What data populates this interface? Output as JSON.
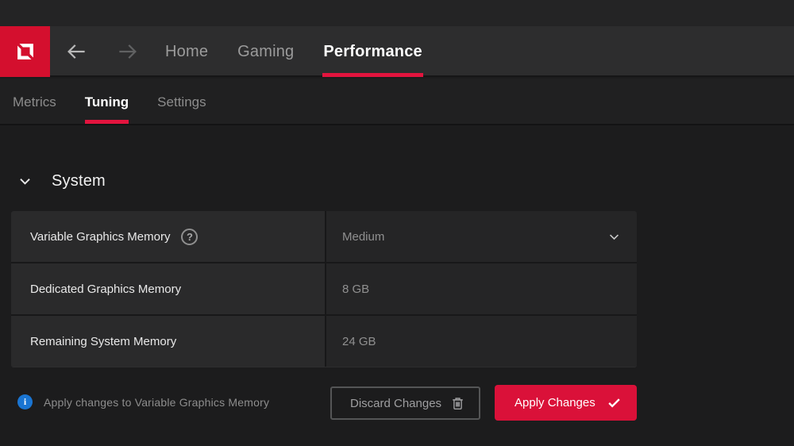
{
  "colors": {
    "accent_red": "#e2143e",
    "logo_red": "#d40f2e",
    "apply_button_red": "#da1139",
    "info_blue": "#1a75d2"
  },
  "topnav": {
    "items": [
      {
        "label": "Home",
        "active": false
      },
      {
        "label": "Gaming",
        "active": false
      },
      {
        "label": "Performance",
        "active": true
      }
    ]
  },
  "subnav": {
    "items": [
      {
        "label": "Metrics",
        "active": false
      },
      {
        "label": "Tuning",
        "active": true
      },
      {
        "label": "Settings",
        "active": false
      }
    ]
  },
  "content": {
    "section_title": "System",
    "rows": [
      {
        "label": "Variable Graphics Memory",
        "value": "Medium",
        "has_help": true,
        "is_dropdown": true
      },
      {
        "label": "Dedicated Graphics Memory",
        "value": "8 GB"
      },
      {
        "label": "Remaining System Memory",
        "value": "24 GB"
      }
    ]
  },
  "footer": {
    "note": "Apply changes to Variable Graphics Memory",
    "discard_button": "Discard Changes",
    "apply_button": "Apply Changes"
  },
  "icons": {
    "amd_logo": "amd-arrow-mark",
    "back": "arrow-left",
    "forward": "arrow-right",
    "section_chevron": "chevron-down",
    "dropdown_chevron": "chevron-down",
    "help_glyph": "?",
    "info_glyph": "i",
    "discard_icon": "trash",
    "apply_icon": "checkmark"
  }
}
